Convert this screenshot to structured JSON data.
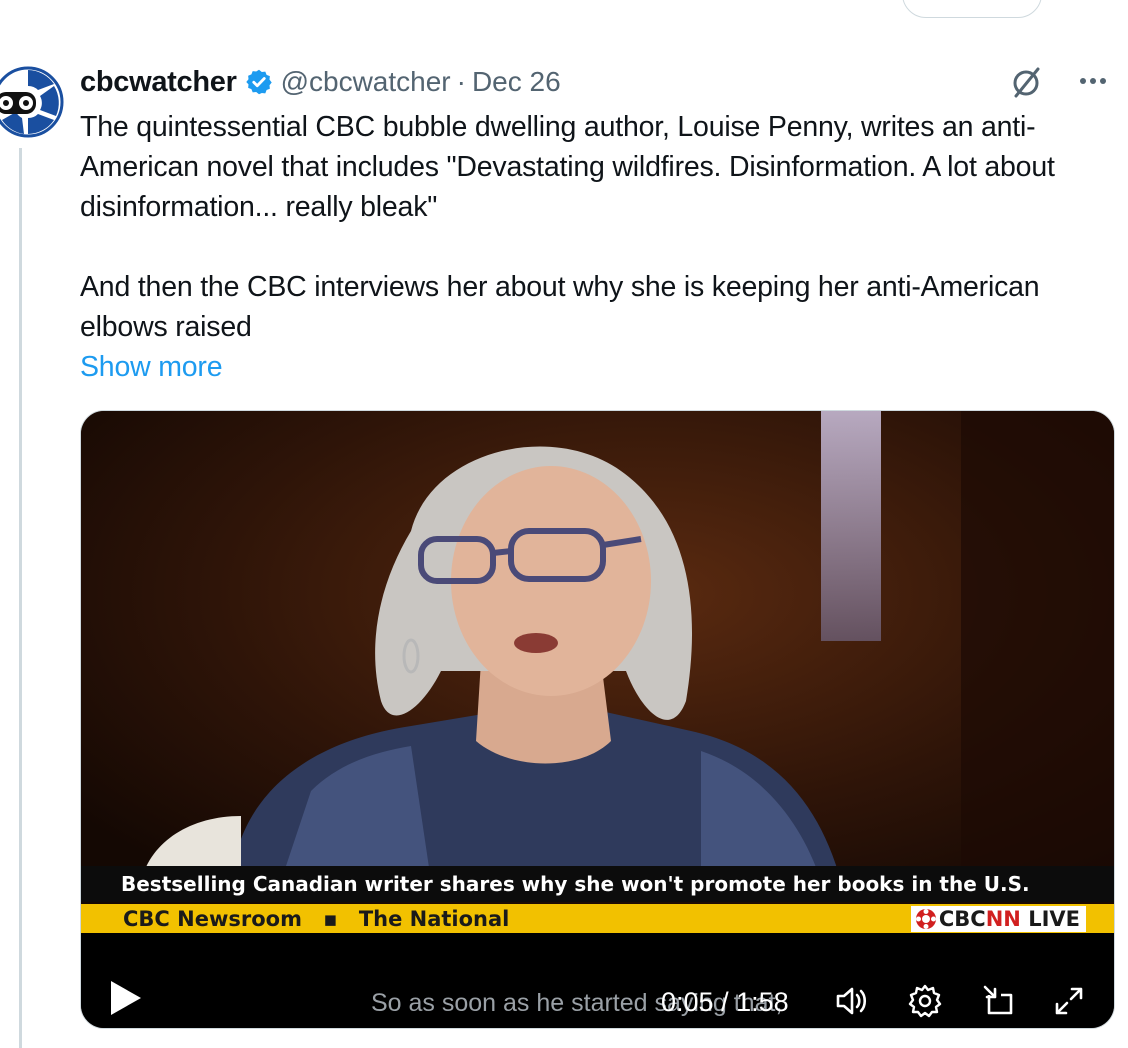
{
  "tweet": {
    "display_name": "cbcwatcher",
    "handle": "@cbcwatcher",
    "separator": "·",
    "date": "Dec 26",
    "text_para1": "The quintessential CBC bubble dwelling author, Louise Penny, writes an anti-American novel that includes \"Devastating wildfires.  Disinformation. A lot about disinformation... really bleak\"",
    "text_para2": "And then the CBC interviews her about why she is keeping her anti-American elbows raised",
    "show_more": "Show more"
  },
  "video": {
    "headline": "Bestselling Canadian writer shares why she won't promote her books in the U.S.",
    "program_left": "CBC Newsroom",
    "program_sep": "▪",
    "program_right": "The National",
    "live_badge_cbc": "CBC",
    "live_badge_nn": "NN",
    "live_badge_live": "LIVE",
    "caption": "So as soon as he started saying that,",
    "time_current": "0:05",
    "time_sep": " / ",
    "time_total": "1:58"
  },
  "icons": {
    "avatar": "cbc-gem-with-binoculars-icon",
    "verified": "verified-badge-icon",
    "grok": "grok-icon",
    "more": "more-dots-icon",
    "play": "play-icon",
    "volume": "volume-icon",
    "settings": "settings-gear-icon",
    "pip": "picture-in-picture-icon",
    "fullscreen": "fullscreen-icon"
  },
  "colors": {
    "link": "#1d9bf0",
    "verified": "#1d9bf0",
    "secondary_text": "#536471",
    "program_bar": "#f2c100",
    "cbc_red": "#d11f1f"
  }
}
